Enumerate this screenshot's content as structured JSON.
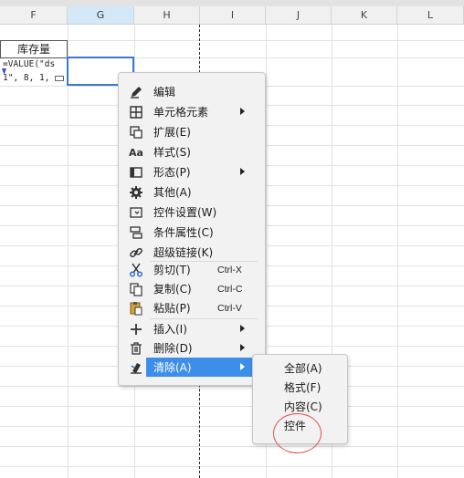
{
  "columns": [
    "F",
    "G",
    "H",
    "I",
    "J",
    "K",
    "L"
  ],
  "selected_column": "G",
  "cells": {
    "header_cell": "库存量",
    "formula_line1": "=VALUE(\"ds",
    "formula_line2": "1\", 8, 1,"
  },
  "context_menu": {
    "items": [
      {
        "label": "编辑",
        "icon": "pencil-icon"
      },
      {
        "label": "单元格元素",
        "icon": "cell-element-icon",
        "submenu": true
      },
      {
        "label": "扩展(E)",
        "icon": "expand-icon"
      },
      {
        "label": "样式(S)",
        "icon": "style-icon"
      },
      {
        "label": "形态(P)",
        "icon": "form-icon",
        "submenu": true
      },
      {
        "label": "其他(A)",
        "icon": "gear-icon"
      },
      {
        "label": "控件设置(W)",
        "icon": "widget-settings-icon"
      },
      {
        "label": "条件属性(C)",
        "icon": "condition-attribute-icon"
      },
      {
        "label": "超级链接(K)",
        "icon": "link-icon"
      },
      {
        "label": "剪切(T)",
        "icon": "scissors-icon",
        "shortcut": "Ctrl-X"
      },
      {
        "label": "复制(C)",
        "icon": "copy-icon",
        "shortcut": "Ctrl-C"
      },
      {
        "label": "粘贴(P)",
        "icon": "paste-icon",
        "shortcut": "Ctrl-V"
      },
      {
        "label": "插入(I)",
        "icon": "plus-icon",
        "submenu": true
      },
      {
        "label": "删除(D)",
        "icon": "trash-icon",
        "submenu": true
      },
      {
        "label": "清除(A)",
        "icon": "eraser-icon",
        "submenu": true,
        "active": true
      }
    ]
  },
  "clear_submenu": {
    "items": [
      "全部(A)",
      "格式(F)",
      "内容(C)",
      "控件"
    ],
    "highlighted": "控件"
  },
  "colors": {
    "accent": "#3d8ee8",
    "selection_border": "#3a78d4",
    "highlight_circle": "#e05050"
  }
}
